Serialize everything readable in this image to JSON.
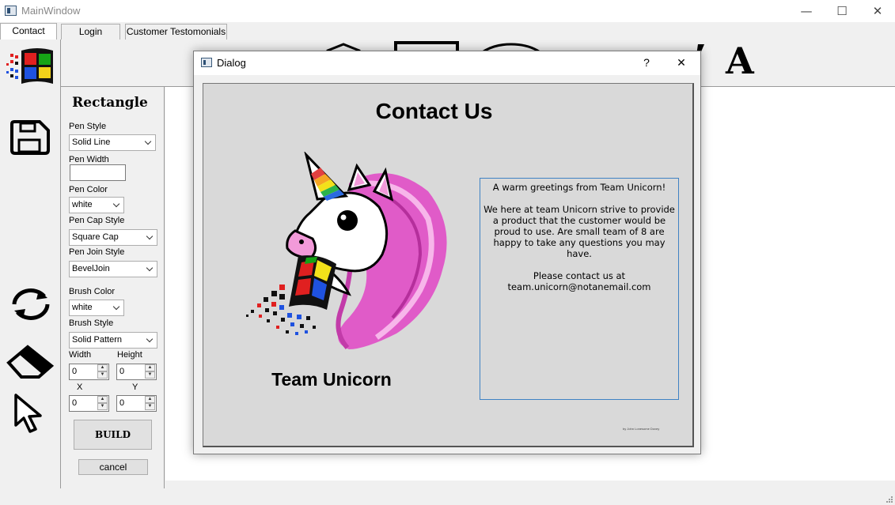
{
  "window": {
    "title": "MainWindow",
    "minimize": "—",
    "maximize": "☐",
    "close": "✕"
  },
  "tabs": [
    {
      "label": "Contact"
    },
    {
      "label": "Login"
    },
    {
      "label": "Customer Testomonials"
    }
  ],
  "toolbar": {
    "text_tool_label": "A"
  },
  "panel": {
    "title": "Rectangle",
    "pen_style_label": "Pen Style",
    "pen_style_value": "Solid Line",
    "pen_width_label": "Pen Width",
    "pen_width_value": "",
    "pen_color_label": "Pen Color",
    "pen_color_value": "white",
    "pen_cap_label": "Pen Cap Style",
    "pen_cap_value": "Square Cap",
    "pen_join_label": "Pen Join Style",
    "pen_join_value": "BevelJoin",
    "brush_color_label": "Brush Color",
    "brush_color_value": "white",
    "brush_style_label": "Brush Style",
    "brush_style_value": "Solid Pattern",
    "width_label": "Width",
    "width_value": "0",
    "height_label": "Height",
    "height_value": "0",
    "x_label": "X",
    "x_value": "0",
    "y_label": "Y",
    "y_value": "0",
    "build_label": "BUILD",
    "cancel_label": "cancel"
  },
  "dialog": {
    "title": "Dialog",
    "help": "?",
    "close": "✕",
    "heading": "Contact Us",
    "team_name": "Team Unicorn",
    "message": "A warm greetings from Team Unicorn!\n\nWe here at team Unicorn strive to provide a product that the customer would be proud to use. Are small team of 8 are happy to take any questions you may have.\n\nPlease contact us at\nteam.unicorn@notanemail.com",
    "credit": "by John Lonesome Dovey"
  },
  "icons": [
    "windows-logo-icon",
    "save-icon",
    "refresh-icon",
    "eraser-icon",
    "pointer-icon",
    "unicorn-logo-icon"
  ],
  "colors": {
    "accent_blue": "#3f82c4",
    "dialog_panel": "#d9d9d9",
    "unicorn_pink": "#e05bc8"
  }
}
